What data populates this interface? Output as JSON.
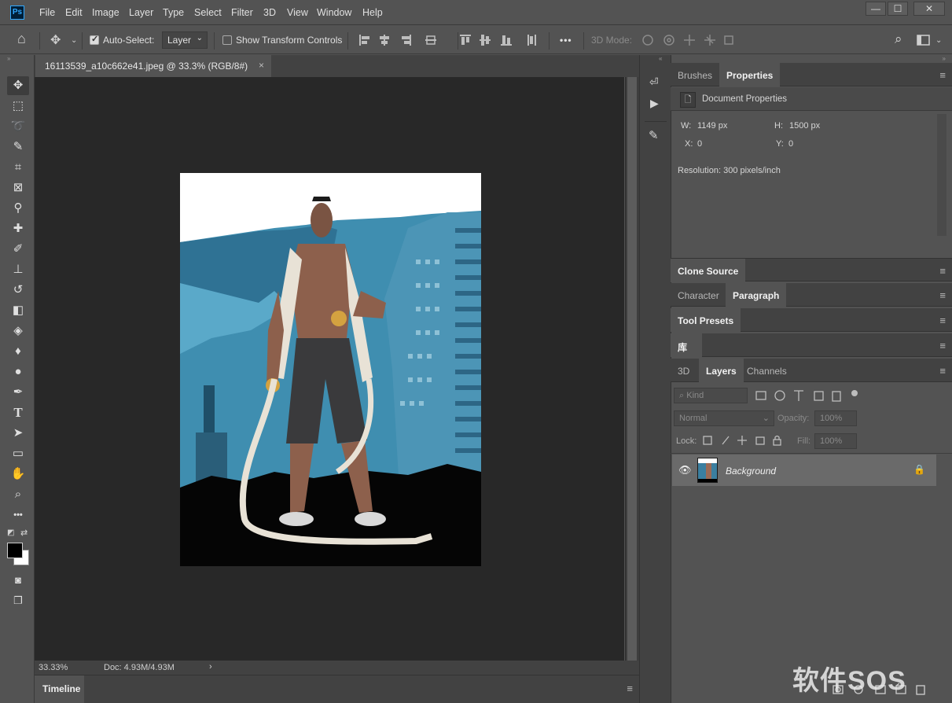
{
  "menubar": {
    "logo": "Ps",
    "items": [
      "File",
      "Edit",
      "Image",
      "Layer",
      "Type",
      "Select",
      "Filter",
      "3D",
      "View",
      "Window",
      "Help"
    ],
    "window_controls": [
      "—",
      "☐",
      "✕"
    ]
  },
  "options": {
    "home_icon": "⌂",
    "move_icon": "✥",
    "auto_select_label": "Auto-Select:",
    "auto_select_checked": true,
    "layer_dropdown": "Layer",
    "show_transform_label": "Show Transform Controls",
    "show_transform_checked": false,
    "more_label": "•••",
    "mode_3d_label": "3D Mode:",
    "search_icon": "⌕"
  },
  "document": {
    "tab_title": "16113539_a10c662e41.jpeg @ 33.3% (RGB/8#)",
    "tab_close": "×",
    "zoom": "33.33%",
    "doc_size": "Doc: 4.93M/4.93M",
    "status_arrow": "›"
  },
  "timeline": {
    "label": "Timeline"
  },
  "tools": [
    {
      "name": "move-tool",
      "glyph": "✥",
      "active": true
    },
    {
      "name": "marquee-tool",
      "glyph": "⬚"
    },
    {
      "name": "lasso-tool",
      "glyph": "➰"
    },
    {
      "name": "quick-select-tool",
      "glyph": "✎"
    },
    {
      "name": "crop-tool",
      "glyph": "⌗"
    },
    {
      "name": "frame-tool",
      "glyph": "⊠"
    },
    {
      "name": "eyedropper-tool",
      "glyph": "⚲"
    },
    {
      "name": "healing-tool",
      "glyph": "✚"
    },
    {
      "name": "brush-tool",
      "glyph": "✐"
    },
    {
      "name": "stamp-tool",
      "glyph": "⊥"
    },
    {
      "name": "history-brush-tool",
      "glyph": "↺"
    },
    {
      "name": "eraser-tool",
      "glyph": "◧"
    },
    {
      "name": "paint-bucket-tool",
      "glyph": "◈"
    },
    {
      "name": "blur-tool",
      "glyph": "♦"
    },
    {
      "name": "dodge-tool",
      "glyph": "●"
    },
    {
      "name": "pen-tool",
      "glyph": "✒"
    },
    {
      "name": "type-tool",
      "glyph": "T"
    },
    {
      "name": "path-select-tool",
      "glyph": "➤"
    },
    {
      "name": "rectangle-tool",
      "glyph": "▭"
    },
    {
      "name": "hand-tool",
      "glyph": "✋"
    },
    {
      "name": "zoom-tool",
      "glyph": "⌕"
    },
    {
      "name": "more-tools",
      "glyph": "•••"
    }
  ],
  "panels": {
    "top_tabs": [
      "Brushes",
      "Properties"
    ],
    "properties": {
      "header": "Document Properties",
      "w_label": "W:",
      "w_value": "1149 px",
      "h_label": "H:",
      "h_value": "1500 px",
      "x_label": "X:",
      "x_value": "0",
      "y_label": "Y:",
      "y_value": "0",
      "resolution": "Resolution: 300 pixels/inch"
    },
    "clone_source": "Clone Source",
    "char_tabs": [
      "Character",
      "Paragraph"
    ],
    "tool_presets": "Tool Presets",
    "library": "库",
    "layer_tabs": [
      "3D",
      "Layers",
      "Channels"
    ],
    "layers": {
      "kind_label": "Kind",
      "blend_mode": "Normal",
      "opacity_label": "Opacity:",
      "opacity_value": "100%",
      "lock_label": "Lock:",
      "fill_label": "Fill:",
      "fill_value": "100%",
      "layer_name": "Background"
    }
  },
  "watermark": "软件SOS"
}
